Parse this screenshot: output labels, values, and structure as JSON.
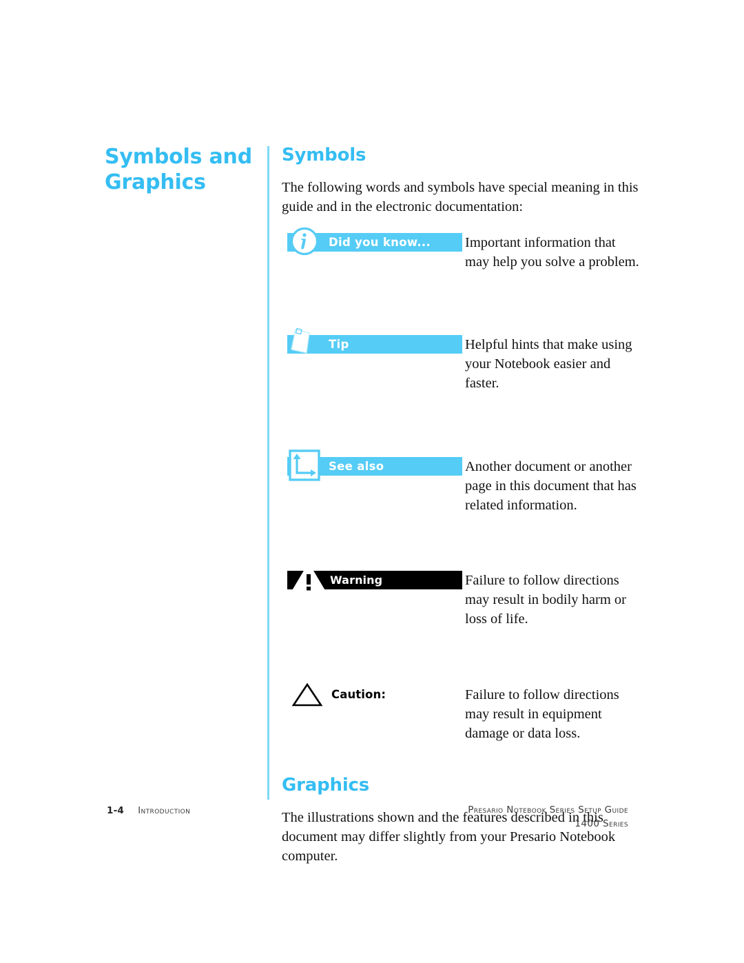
{
  "colors": {
    "accent": "#34BDF2",
    "badge_bar": "#55CCF5",
    "divider": "#7FD9F7",
    "warning_bar": "#000000",
    "body_text": "#111111"
  },
  "chapter": {
    "title_line1": "Symbols and",
    "title_line2": "Graphics"
  },
  "sections": {
    "symbols": {
      "heading": "Symbols",
      "intro": "The following words and symbols have special meaning in this guide and in the electronic documentation:"
    },
    "graphics": {
      "heading": "Graphics",
      "body": "The illustrations shown and the features described in this document may differ slightly from your Presario Notebook computer."
    }
  },
  "symbol_rows": [
    {
      "icon": "info-circle-icon",
      "label": "Did you know...",
      "style": "light",
      "description": "Important information that may help you solve a problem."
    },
    {
      "icon": "note-page-icon",
      "label": "Tip",
      "style": "light",
      "description": "Helpful hints that make using your Notebook easier and faster."
    },
    {
      "icon": "see-also-arrows-icon",
      "label": "See also",
      "style": "light",
      "description": "Another document or another page in this document that has related information."
    },
    {
      "icon": "warning-triangle-icon",
      "label": "Warning",
      "style": "dark",
      "description": "Failure to follow directions may result in bodily harm or loss of life."
    },
    {
      "icon": "caution-triangle-icon",
      "label": "Caution:",
      "style": "plain",
      "description": "Failure to follow directions may result in equipment damage or data loss."
    }
  ],
  "footer": {
    "page_number": "1-4",
    "chapter_name": "Introduction",
    "guide_title": "Presario Notebook Series Setup Guide",
    "series": "1400 Series"
  }
}
